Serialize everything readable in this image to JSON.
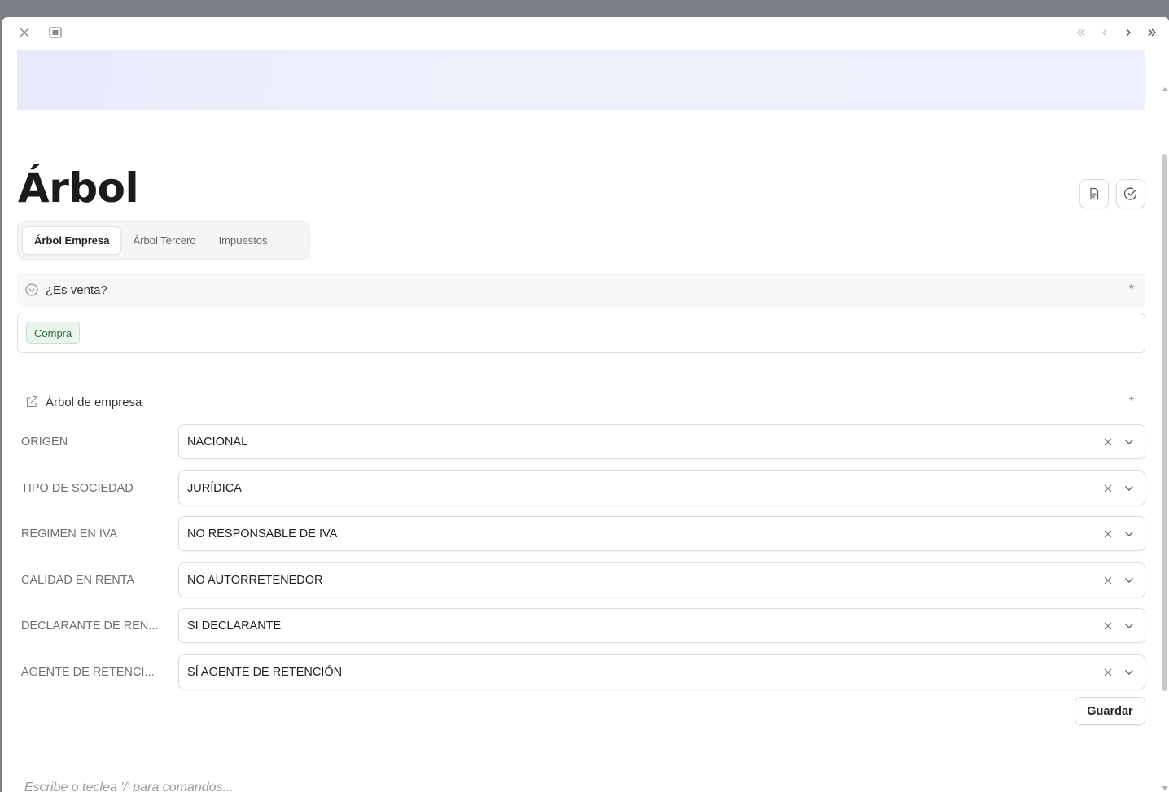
{
  "page": {
    "title": "Árbol"
  },
  "tabs": [
    {
      "label": "Árbol Empresa",
      "active": true
    },
    {
      "label": "Árbol Tercero",
      "active": false
    },
    {
      "label": "Impuestos",
      "active": false
    }
  ],
  "section_sale": {
    "title": "¿Es venta?",
    "asterisk": "*",
    "selected_chip": "Compra"
  },
  "section_tree": {
    "title": "Árbol de empresa",
    "asterisk": "*",
    "fields": [
      {
        "label": "ORIGEN",
        "value": "NACIONAL"
      },
      {
        "label": "TIPO DE SOCIEDAD",
        "value": "JURÍDICA"
      },
      {
        "label": "REGIMEN EN IVA",
        "value": "NO RESPONSABLE DE IVA"
      },
      {
        "label": "CALIDAD EN RENTA",
        "value": "NO AUTORRETENEDOR"
      },
      {
        "label": "DECLARANTE DE REN...",
        "value": "SI DECLARANTE"
      },
      {
        "label": "AGENTE DE RETENCI...",
        "value": "SÍ AGENTE DE RETENCIÓN"
      }
    ],
    "save_label": "Guardar"
  },
  "editor": {
    "placeholder": "Escribe o teclea '/' para comandos..."
  },
  "colors": {
    "cover": "#eef1fc",
    "chip_bg": "#e9f5ec",
    "chip_text": "#2d6a3f"
  }
}
